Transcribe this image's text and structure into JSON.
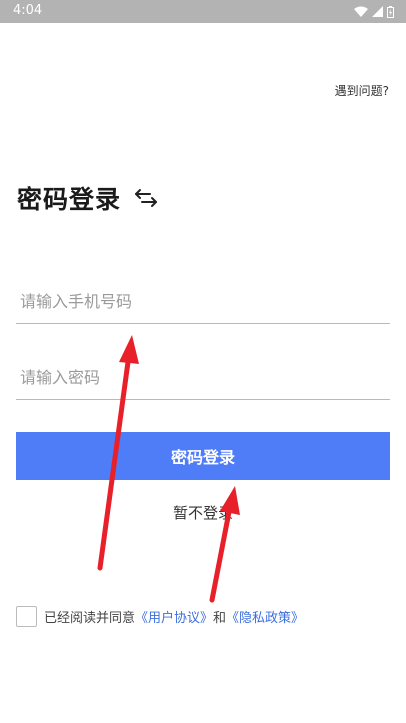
{
  "status_bar": {
    "time": "4:04"
  },
  "header": {
    "help_link": "遇到问题?"
  },
  "login": {
    "title": "密码登录",
    "switch_icon": "swap-arrows-icon",
    "phone_placeholder": "请输入手机号码",
    "password_placeholder": "请输入密码",
    "submit_label": "密码登录",
    "skip_label": "暂不登录"
  },
  "agreement": {
    "prefix": "已经阅读并同意",
    "user_agreement": "《用户协议》",
    "conjunction": "和",
    "privacy_policy": "《隐私政策》",
    "checked": false
  },
  "colors": {
    "status_bar": "#b3b3b3",
    "primary_button": "#4f7cf7",
    "link": "#3c6fdd",
    "annotation_arrow": "#e8202a"
  }
}
